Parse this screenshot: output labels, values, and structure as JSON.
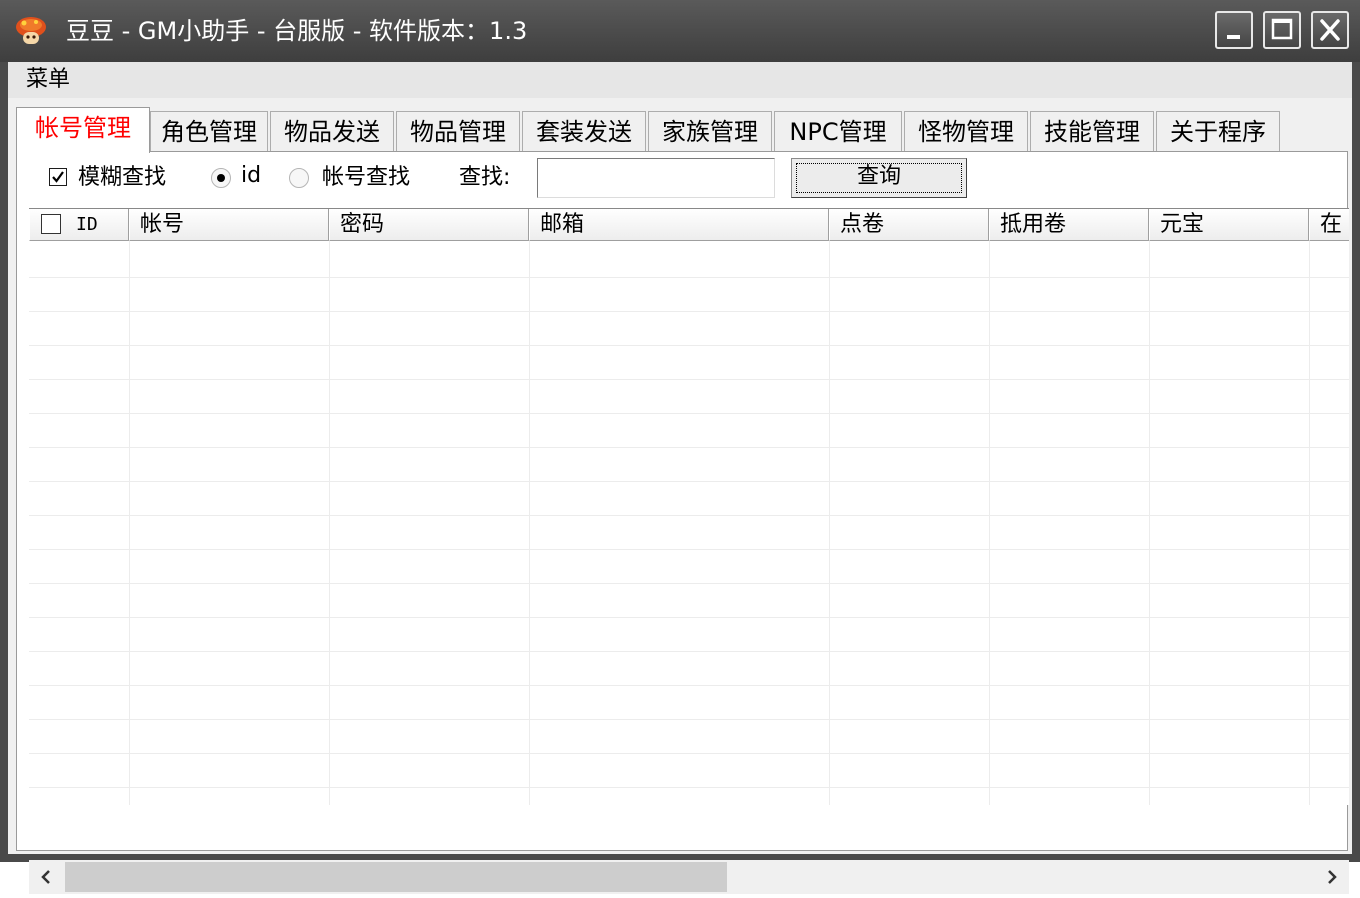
{
  "window": {
    "title": "豆豆 - GM小助手 - 台服版 - 软件版本：1.3",
    "app_icon": "mushroom-icon",
    "controls": [
      "minimize-icon",
      "maximize-icon",
      "close-icon"
    ]
  },
  "menubar": {
    "items": [
      {
        "label": "菜单"
      }
    ]
  },
  "tabs": [
    {
      "label": "帐号管理",
      "active": true
    },
    {
      "label": "角色管理"
    },
    {
      "label": "物品发送"
    },
    {
      "label": "物品管理"
    },
    {
      "label": "套装发送"
    },
    {
      "label": "家族管理"
    },
    {
      "label": "NPC管理"
    },
    {
      "label": "怪物管理"
    },
    {
      "label": "技能管理"
    },
    {
      "label": "关于程序"
    }
  ],
  "search": {
    "fuzzy_label": "模糊查找",
    "fuzzy_checked": true,
    "mode_options": [
      {
        "label": "id",
        "selected": true
      },
      {
        "label": "帐号查找",
        "selected": false
      }
    ],
    "find_label": "查找:",
    "input_value": "",
    "query_button": "查询"
  },
  "table": {
    "columns": [
      "ID",
      "帐号",
      "密码",
      "邮箱",
      "点卷",
      "抵用卷",
      "元宝",
      "在"
    ],
    "select_all_checked": false,
    "rows": []
  },
  "colors": {
    "title_bar": "#4a4a4a",
    "active_tab_text": "#ff0000",
    "grid_line": "#ececec"
  }
}
